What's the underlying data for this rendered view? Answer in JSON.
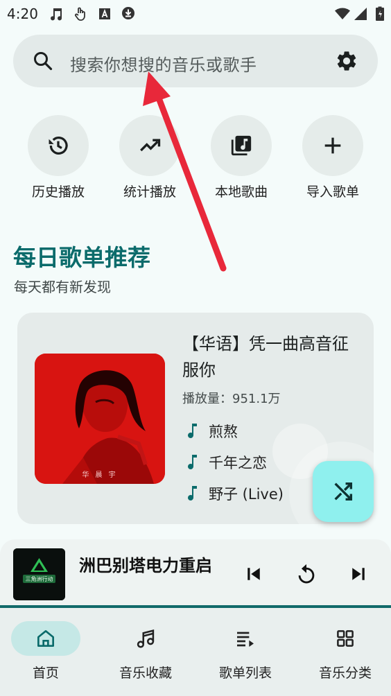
{
  "status_bar": {
    "time": "4:20",
    "icons": [
      "music-note-icon",
      "touch-icon",
      "a-box-icon",
      "download-icon",
      "wifi-icon",
      "signal-icon",
      "battery-icon"
    ]
  },
  "search": {
    "placeholder": "搜索你想搜的音乐或歌手",
    "icons": [
      "search-icon",
      "settings-icon"
    ]
  },
  "quick_actions": [
    {
      "label": "历史播放",
      "icon": "history-icon"
    },
    {
      "label": "统计播放",
      "icon": "trending-up-icon"
    },
    {
      "label": "本地歌曲",
      "icon": "library-music-icon"
    },
    {
      "label": "导入歌单",
      "icon": "add-icon"
    }
  ],
  "daily": {
    "title": "每日歌单推荐",
    "subtitle": "每天都有新发现"
  },
  "playlist": {
    "title": "【华语】凭一曲高音征服你",
    "play_count": "播放量：951.1万",
    "cover_caption": "华 晨 宇",
    "songs": [
      "煎熬",
      "千年之恋",
      "野子 (Live)"
    ]
  },
  "fab": {
    "icon": "shuffle-icon"
  },
  "player": {
    "title": "洲巴别塔电力重启",
    "cover_text": "三角洲行动",
    "icons": [
      "skip-previous-icon",
      "replay-icon",
      "skip-next-icon"
    ]
  },
  "bottom_nav": [
    {
      "label": "首页",
      "icon": "home-icon",
      "active": true
    },
    {
      "label": "音乐收藏",
      "icon": "music-notes-icon",
      "active": false
    },
    {
      "label": "歌单列表",
      "icon": "queue-music-icon",
      "active": false
    },
    {
      "label": "音乐分类",
      "icon": "grid-icon",
      "active": false
    }
  ],
  "colors": {
    "accent": "#0b6b6b",
    "fab": "#8ff0ee",
    "nav_active_pill": "#c5e8e6",
    "arrow": "#e8283a"
  }
}
